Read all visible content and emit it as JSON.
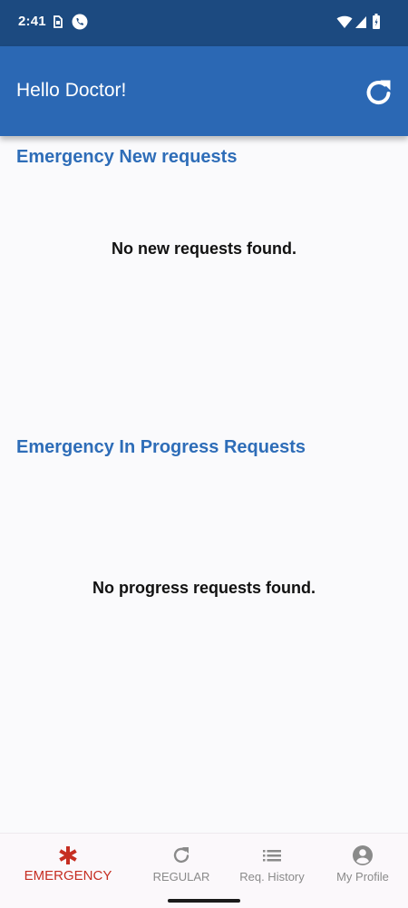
{
  "status_bar": {
    "time": "2:41",
    "icons": [
      "sim-icon",
      "phone-call-icon",
      "wifi-icon",
      "signal-icon",
      "battery-icon"
    ]
  },
  "app_bar": {
    "title": "Hello Doctor!",
    "refresh_icon": "refresh-icon"
  },
  "sections": {
    "new": {
      "title": "Emergency New requests",
      "empty_message": "No new requests found."
    },
    "in_progress": {
      "title": "Emergency In Progress Requests",
      "empty_message": "No progress requests found."
    }
  },
  "bottom_nav": {
    "items": [
      {
        "label": "EMERGENCY",
        "icon": "asterisk-icon",
        "active": true
      },
      {
        "label": "REGULAR",
        "icon": "refresh-icon",
        "active": false
      },
      {
        "label": "Req. History",
        "icon": "list-icon",
        "active": false
      },
      {
        "label": "My Profile",
        "icon": "account-circle-icon",
        "active": false
      }
    ]
  },
  "colors": {
    "status_bar": "#1c4a80",
    "app_bar": "#2b68b4",
    "section_title": "#2e6db8",
    "active_nav": "#c62e22",
    "inactive_nav": "#8a8a8a"
  }
}
